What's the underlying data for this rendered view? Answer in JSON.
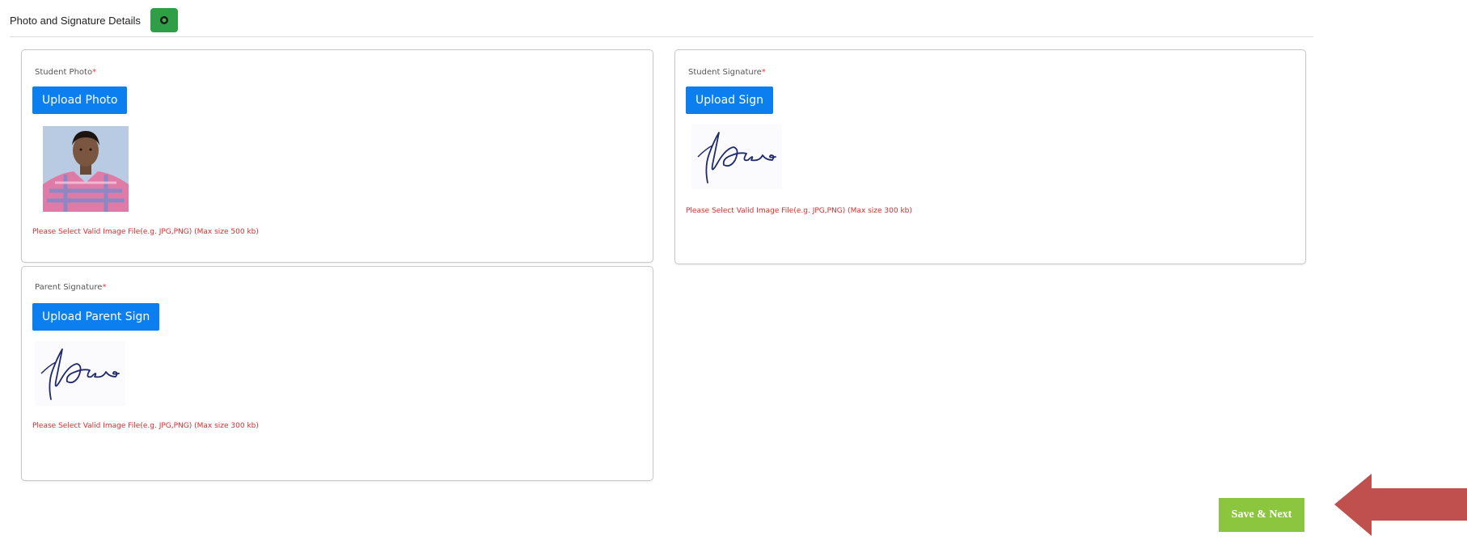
{
  "header": {
    "title": "Photo and Signature Details"
  },
  "student_photo": {
    "label": "Student Photo",
    "required_mark": "*",
    "button": "Upload Photo",
    "hint": "Please Select Valid Image File(e.g. JPG,PNG) (Max size 500 kb)"
  },
  "student_signature": {
    "label": "Student Signature",
    "required_mark": "*",
    "button": "Upload Sign",
    "hint": "Please Select Valid Image File(e.g. JPG,PNG) (Max size 300 kb)"
  },
  "parent_signature": {
    "label": "Parent Signature",
    "required_mark": "*",
    "button": "Upload Parent Sign",
    "hint": "Please Select Valid Image File(e.g. JPG,PNG) (Max size 300 kb)"
  },
  "footer": {
    "save_label": "Save & Next"
  },
  "colors": {
    "primary_button": "#0b7ff0",
    "toggle_green": "#2e9e47",
    "save_green": "#8cc63f",
    "hint_red": "#d32f2f",
    "arrow_red": "#c0504d"
  }
}
